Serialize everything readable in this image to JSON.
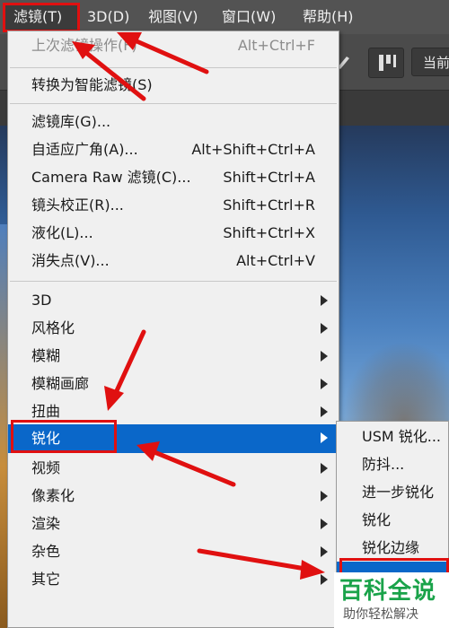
{
  "menubar": {
    "items": [
      {
        "label": "滤镜(T)"
      },
      {
        "label": "3D(D)"
      },
      {
        "label": "视图(V)"
      },
      {
        "label": "窗口(W)"
      },
      {
        "label": "帮助(H)"
      }
    ]
  },
  "options_bar": {
    "current_field_text": "当前"
  },
  "filter_menu": {
    "items": [
      {
        "label": "上次滤镜操作(F)",
        "shortcut": "Alt+Ctrl+F",
        "enabled": false
      },
      {
        "label": "转换为智能滤镜(S)",
        "shortcut": ""
      },
      {
        "label": "滤镜库(G)...",
        "shortcut": ""
      },
      {
        "label": "自适应广角(A)...",
        "shortcut": "Alt+Shift+Ctrl+A"
      },
      {
        "label": "Camera Raw 滤镜(C)...",
        "shortcut": "Shift+Ctrl+A"
      },
      {
        "label": "镜头校正(R)...",
        "shortcut": "Shift+Ctrl+R"
      },
      {
        "label": "液化(L)...",
        "shortcut": "Shift+Ctrl+X"
      },
      {
        "label": "消失点(V)...",
        "shortcut": "Alt+Ctrl+V"
      },
      {
        "label": "3D",
        "submenu": true
      },
      {
        "label": "风格化",
        "submenu": true
      },
      {
        "label": "模糊",
        "submenu": true
      },
      {
        "label": "模糊画廊",
        "submenu": true
      },
      {
        "label": "扭曲",
        "submenu": true
      },
      {
        "label": "锐化",
        "submenu": true,
        "active": true
      },
      {
        "label": "视频",
        "submenu": true
      },
      {
        "label": "像素化",
        "submenu": true
      },
      {
        "label": "渲染",
        "submenu": true
      },
      {
        "label": "杂色",
        "submenu": true
      },
      {
        "label": "其它",
        "submenu": true
      }
    ]
  },
  "sharpen_submenu": {
    "items": [
      {
        "label": "USM 锐化..."
      },
      {
        "label": "防抖..."
      },
      {
        "label": "进一步锐化"
      },
      {
        "label": "锐化"
      },
      {
        "label": "锐化边缘"
      },
      {
        "label": ""
      }
    ]
  },
  "watermark": {
    "title": "百科全说",
    "subtitle": "助你轻松解决"
  },
  "colors": {
    "highlight": "#0a67c9",
    "annotation_red": "#e01010",
    "watermark_green": "#1aa34a"
  }
}
